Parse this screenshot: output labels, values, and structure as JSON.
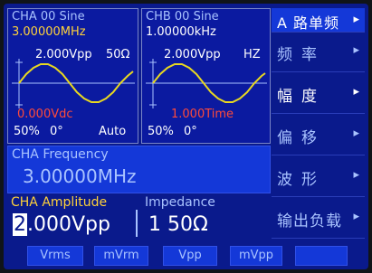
{
  "cha": {
    "title": "CHA 00 Sine",
    "frequency": "3.00000MHz",
    "amplitude": "2.000Vpp",
    "impedance": "50Ω",
    "offset": "0.000Vdc",
    "duty": "50%",
    "phase": "0°",
    "mode": "Auto"
  },
  "chb": {
    "title": "CHB 00 Sine",
    "frequency": "1.00000kHz",
    "amplitude": "2.000Vpp",
    "unit": "HZ",
    "offset": "1.000Time",
    "duty": "50%",
    "phase": "0°"
  },
  "frequency_panel": {
    "label": "CHA Frequency",
    "value": "3.00000MHz"
  },
  "edit": {
    "amplitude_label": "CHA Amplitude",
    "amplitude_cursor_digit": "2",
    "amplitude_rest": ".000Vpp",
    "impedance_label": "Impedance",
    "impedance_value": "1 50Ω"
  },
  "menu": {
    "items": [
      {
        "label": "A 路单频",
        "active": true
      },
      {
        "label": "频率",
        "active": false
      },
      {
        "label": "幅度",
        "active": true
      },
      {
        "label": "偏移",
        "active": false
      },
      {
        "label": "波形",
        "active": false
      },
      {
        "label": "输出负载",
        "active": false
      }
    ],
    "arrow": "▸"
  },
  "softkeys": [
    "Vrms",
    "mVrm",
    "Vpp",
    "mVpp",
    ""
  ],
  "colors": {
    "background": "#0a1a8c",
    "highlight": "#1438d8",
    "label": "#a9c3ff",
    "value_yellow": "#ffd23a",
    "offset_red": "#ff4a3a",
    "wave": "#e8d820"
  }
}
